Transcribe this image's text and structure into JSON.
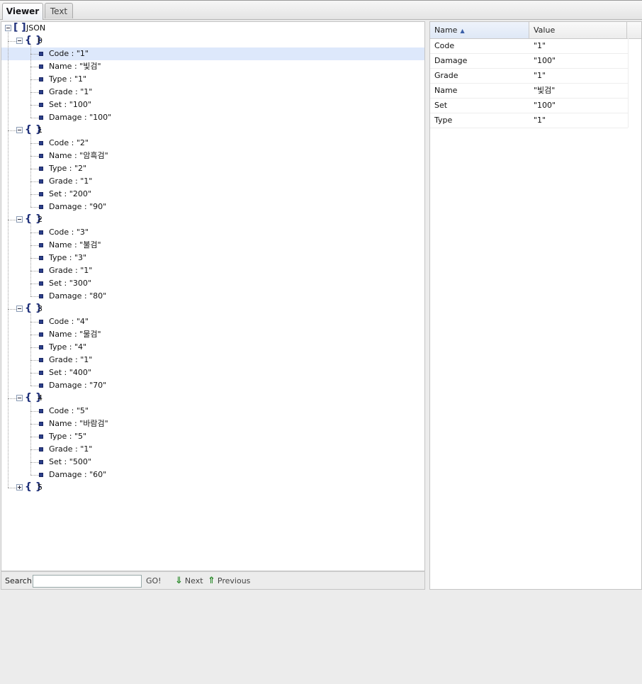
{
  "tabs": {
    "viewer": "Viewer",
    "text": "Text"
  },
  "tree": {
    "root_label": "JSON",
    "nodes": [
      {
        "index": "0",
        "expanded": true,
        "fields": [
          "Code : \"1\"",
          "Name : \"빛검\"",
          "Type : \"1\"",
          "Grade : \"1\"",
          "Set : \"100\"",
          "Damage : \"100\""
        ]
      },
      {
        "index": "1",
        "expanded": true,
        "fields": [
          "Code : \"2\"",
          "Name : \"암흑검\"",
          "Type : \"2\"",
          "Grade : \"1\"",
          "Set : \"200\"",
          "Damage : \"90\""
        ]
      },
      {
        "index": "2",
        "expanded": true,
        "fields": [
          "Code : \"3\"",
          "Name : \"불검\"",
          "Type : \"3\"",
          "Grade : \"1\"",
          "Set : \"300\"",
          "Damage : \"80\""
        ]
      },
      {
        "index": "3",
        "expanded": true,
        "fields": [
          "Code : \"4\"",
          "Name : \"물검\"",
          "Type : \"4\"",
          "Grade : \"1\"",
          "Set : \"400\"",
          "Damage : \"70\""
        ]
      },
      {
        "index": "4",
        "expanded": true,
        "fields": [
          "Code : \"5\"",
          "Name : \"바람검\"",
          "Type : \"5\"",
          "Grade : \"1\"",
          "Set : \"500\"",
          "Damage : \"60\""
        ]
      },
      {
        "index": "5",
        "expanded": false,
        "fields": []
      }
    ]
  },
  "search": {
    "label": "Search:",
    "value": "",
    "go_label": "GO!",
    "next_label": "Next",
    "previous_label": "Previous"
  },
  "grid": {
    "headers": {
      "name": "Name",
      "value": "Value"
    },
    "rows": [
      {
        "name": "Code",
        "value": "\"1\""
      },
      {
        "name": "Damage",
        "value": "\"100\""
      },
      {
        "name": "Grade",
        "value": "\"1\""
      },
      {
        "name": "Name",
        "value": "\"빛검\""
      },
      {
        "name": "Set",
        "value": "\"100\""
      },
      {
        "name": "Type",
        "value": "\"1\""
      }
    ]
  },
  "colors": {
    "selected_row": "#dde8fb",
    "bracket": "#1e2f7a",
    "leaf_icon": "#2a3f8a",
    "nav_arrow": "#2a8a2a"
  }
}
